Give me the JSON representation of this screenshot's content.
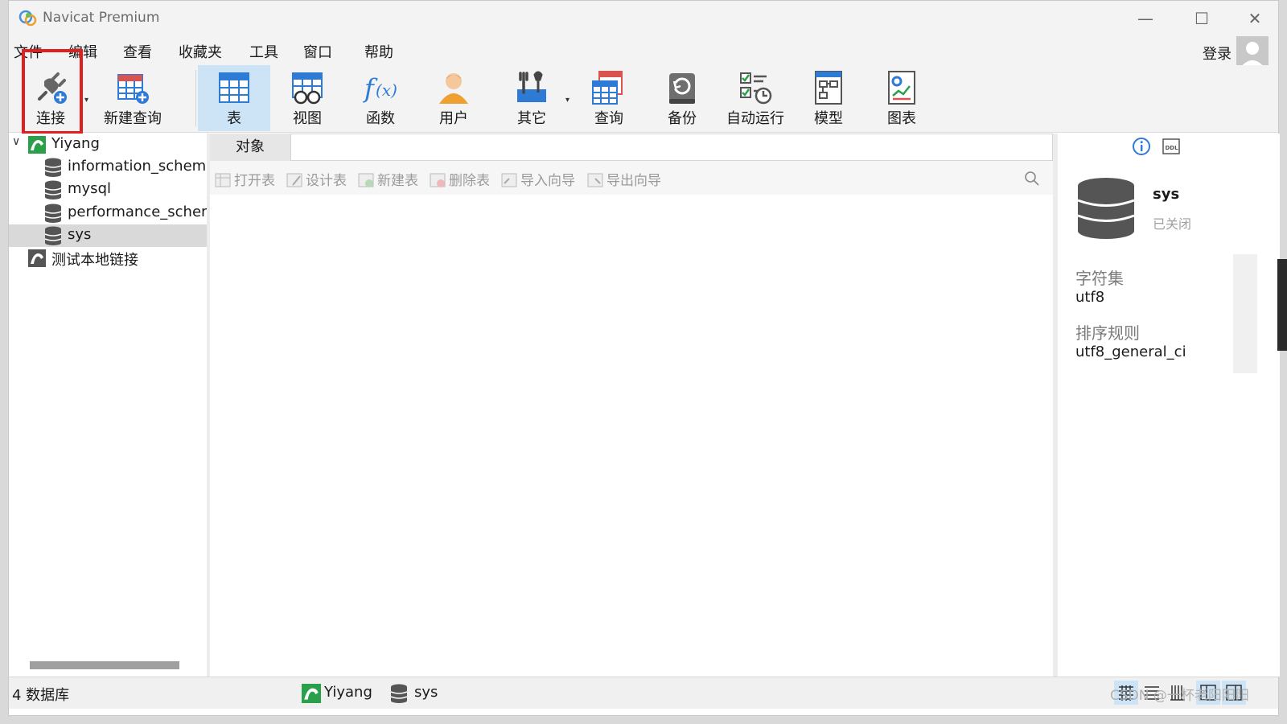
{
  "window": {
    "title": "Navicat Premium",
    "controls": {
      "minimize": "—",
      "maximize": "☐",
      "close": "✕"
    }
  },
  "menu": {
    "items": [
      "文件",
      "编辑",
      "查看",
      "收藏夹",
      "工具",
      "窗口",
      "帮助"
    ],
    "login": "登录"
  },
  "toolbar": {
    "buttons": [
      {
        "label": "连接",
        "icon": "plug-icon"
      },
      {
        "label": "新建查询",
        "icon": "new-query-icon"
      },
      {
        "label": "表",
        "icon": "table-icon"
      },
      {
        "label": "视图",
        "icon": "view-icon"
      },
      {
        "label": "函数",
        "icon": "function-icon"
      },
      {
        "label": "用户",
        "icon": "user-icon"
      },
      {
        "label": "其它",
        "icon": "tools-icon"
      },
      {
        "label": "查询",
        "icon": "query-icon"
      },
      {
        "label": "备份",
        "icon": "backup-icon"
      },
      {
        "label": "自动运行",
        "icon": "schedule-icon"
      },
      {
        "label": "模型",
        "icon": "model-icon"
      },
      {
        "label": "图表",
        "icon": "chart-icon"
      }
    ],
    "active": "表"
  },
  "nav": {
    "connections": [
      {
        "name": "Yiyang",
        "expanded": true,
        "databases": [
          "information_schema",
          "mysql",
          "performance_schema",
          "sys"
        ],
        "selected": "sys"
      },
      {
        "name": "测试本地链接",
        "expanded": false
      }
    ]
  },
  "center": {
    "tab": "对象",
    "actions": [
      "打开表",
      "设计表",
      "新建表",
      "删除表",
      "导入向导",
      "导出向导"
    ]
  },
  "info": {
    "name": "sys",
    "status": "已关闭",
    "charset_label": "字符集",
    "charset_value": "utf8",
    "collation_label": "排序规则",
    "collation_value": "utf8_general_ci"
  },
  "status": {
    "count": "4 数据库",
    "connection": "Yiyang",
    "database": "sys"
  },
  "watermark": "CSDN @一杯老阳阳阳",
  "colors": {
    "active_tab": "#cde4f7",
    "highlight_box": "#e02020",
    "selected_row": "#d9d9d9"
  }
}
